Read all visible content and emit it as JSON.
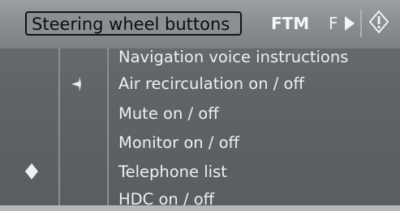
{
  "header": {
    "tabs": [
      {
        "label": "Steering wheel buttons",
        "active": true
      },
      {
        "label": "FTM",
        "active": false
      },
      {
        "label": "F",
        "active": false
      }
    ],
    "icons": [
      "arrow-right-icon",
      "info-icon"
    ]
  },
  "menu": {
    "items": [
      {
        "label": "Navigation voice instructions"
      },
      {
        "label": "Air recirculation on / off"
      },
      {
        "label": "Mute on / off"
      },
      {
        "label": "Monitor on / off"
      },
      {
        "label": "Telephone list"
      },
      {
        "label": "HDC on / off"
      }
    ]
  },
  "colors": {
    "background": "#5e6366",
    "header": "#8a9093",
    "text": "#eef0f1",
    "tab_border": "#121415"
  }
}
